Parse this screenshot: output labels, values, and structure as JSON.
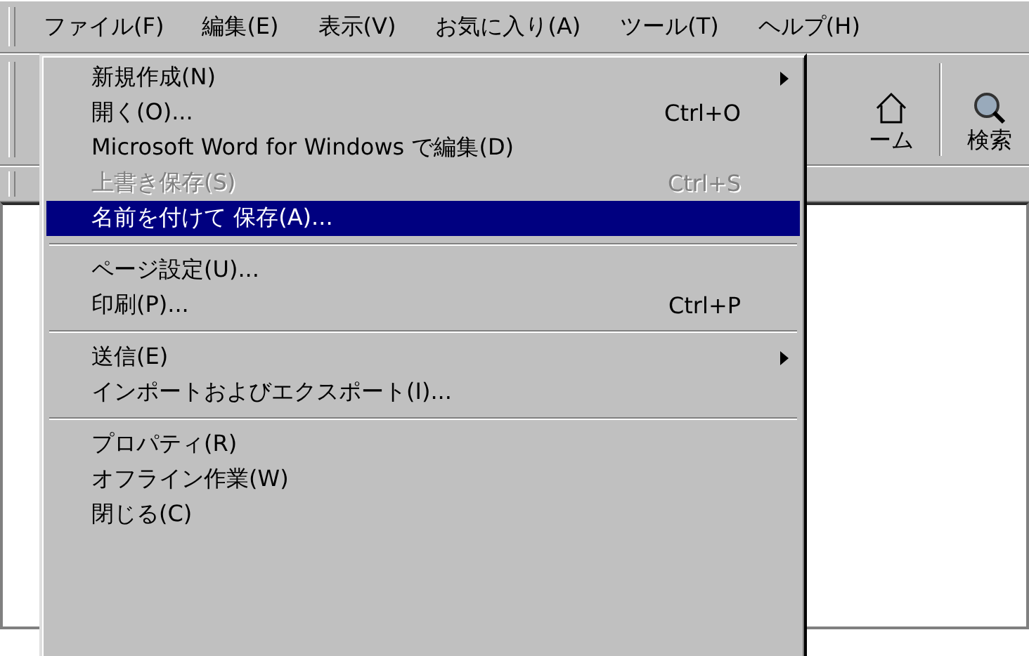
{
  "menubar": [
    {
      "label": "ファイル(F)",
      "selected": true
    },
    {
      "label": "編集(E)",
      "selected": false
    },
    {
      "label": "表示(V)",
      "selected": false
    },
    {
      "label": "お気に入り(A)",
      "selected": false
    },
    {
      "label": "ツール(T)",
      "selected": false
    },
    {
      "label": "ヘルプ(H)",
      "selected": false
    }
  ],
  "toolbar": [
    {
      "kind": "home",
      "label": "ーム"
    },
    {
      "kind": "search",
      "label": "検索"
    }
  ],
  "file_menu": [
    {
      "kind": "item",
      "label": "新規作成(N)",
      "submenu": true,
      "disabled": false,
      "selected": false
    },
    {
      "kind": "item",
      "label": "開く(O)...",
      "shortcut": "Ctrl+O",
      "submenu": false,
      "disabled": false,
      "selected": false
    },
    {
      "kind": "item",
      "label": "Microsoft Word for Windows で編集(D)",
      "submenu": false,
      "disabled": false,
      "selected": false
    },
    {
      "kind": "item",
      "label": "上書き保存(S)",
      "shortcut": "Ctrl+S",
      "submenu": false,
      "disabled": true,
      "selected": false
    },
    {
      "kind": "item",
      "label": "名前を付けて 保存(A)...",
      "submenu": false,
      "disabled": false,
      "selected": true
    },
    {
      "kind": "separator"
    },
    {
      "kind": "item",
      "label": "ページ設定(U)...",
      "submenu": false,
      "disabled": false,
      "selected": false
    },
    {
      "kind": "item",
      "label": "印刷(P)...",
      "shortcut": "Ctrl+P",
      "submenu": false,
      "disabled": false,
      "selected": false
    },
    {
      "kind": "separator"
    },
    {
      "kind": "item",
      "label": "送信(E)",
      "submenu": true,
      "disabled": false,
      "selected": false
    },
    {
      "kind": "item",
      "label": "インポートおよびエクスポート(I)...",
      "submenu": false,
      "disabled": false,
      "selected": false
    },
    {
      "kind": "separator"
    },
    {
      "kind": "item",
      "label": "プロパティ(R)",
      "submenu": false,
      "disabled": false,
      "selected": false
    },
    {
      "kind": "item",
      "label": "オフライン作業(W)",
      "submenu": false,
      "disabled": false,
      "selected": false
    },
    {
      "kind": "item",
      "label": "閉じる(C)",
      "submenu": false,
      "disabled": false,
      "selected": false
    }
  ]
}
